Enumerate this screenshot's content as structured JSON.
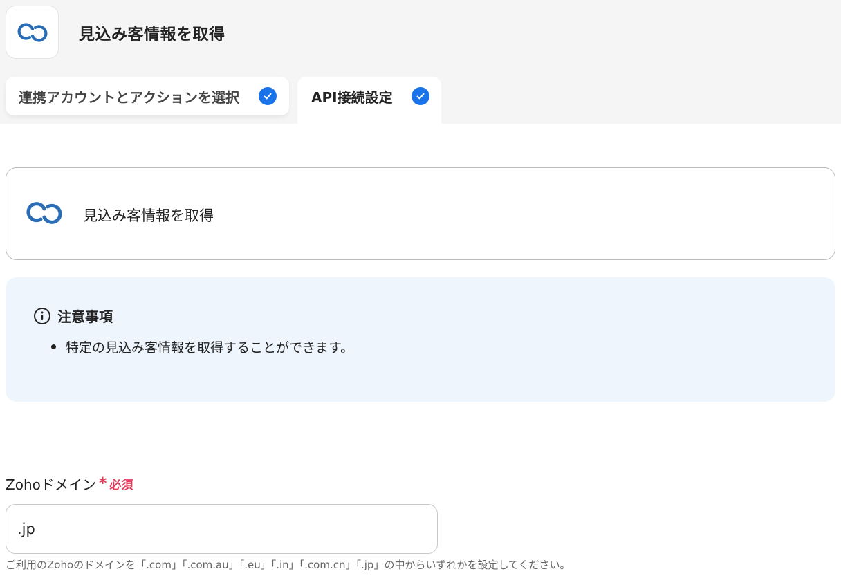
{
  "header": {
    "title": "見込み客情報を取得",
    "app_icon": "zoho-crm-icon",
    "accent_color": "#1a73e8"
  },
  "tabs": [
    {
      "label": "連携アカウントとアクションを選択",
      "completed": true
    },
    {
      "label": "API接続設定",
      "completed": true,
      "active": true
    }
  ],
  "operation": {
    "label": "見込み客情報を取得",
    "icon": "zoho-crm-icon"
  },
  "notice": {
    "title": "注意事項",
    "icon": "info-icon",
    "items": [
      "特定の見込み客情報を取得することができます。"
    ]
  },
  "form": {
    "domain_field": {
      "label": "Zohoドメイン",
      "required_mark": "*",
      "required_text": "必須",
      "value": ".jp",
      "help": "ご利用のZohoのドメインを「.com」「.com.au」「.eu」「.in」「.com.cn」「.jp」の中からいずれかを設定してください。"
    }
  }
}
